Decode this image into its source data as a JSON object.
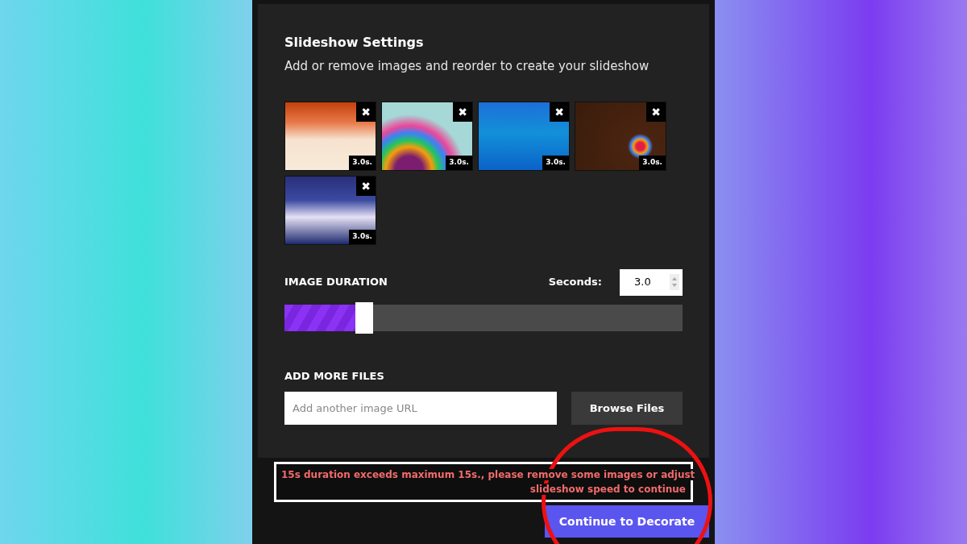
{
  "title": "Slideshow Settings",
  "subtitle": "Add or remove images and reorder to create your slideshow",
  "images": [
    {
      "duration": "3.0s.",
      "remove": "✖"
    },
    {
      "duration": "3.0s.",
      "remove": "✖"
    },
    {
      "duration": "3.0s.",
      "remove": "✖"
    },
    {
      "duration": "3.0s.",
      "remove": "✖"
    },
    {
      "duration": "3.0s.",
      "remove": "✖"
    }
  ],
  "image_duration": {
    "label": "IMAGE DURATION",
    "seconds_label": "Seconds:",
    "value": "3.0",
    "level": 0.2
  },
  "add_files": {
    "label": "ADD MORE FILES",
    "placeholder": "Add another image URL",
    "button": "Browse Files"
  },
  "error": {
    "line_1": "15s duration exceeds maximum 15s., please remove some images or adjust",
    "line_2": "slideshow speed to continue"
  },
  "continue_button": "Continue to Decorate"
}
